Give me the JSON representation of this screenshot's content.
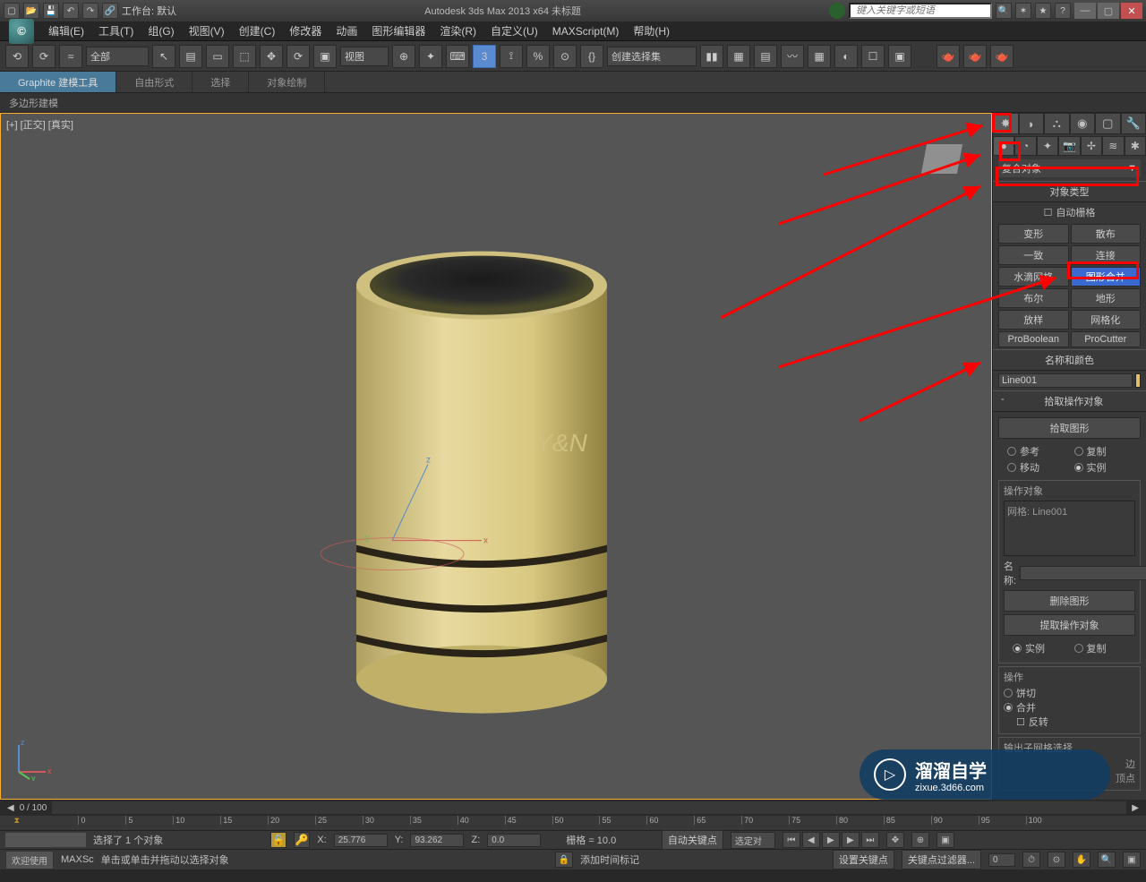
{
  "titlebar": {
    "workspace_label": "工作台: 默认",
    "app_title": "Autodesk 3ds Max  2013 x64      未标题",
    "search_placeholder": "键入关键字或短语"
  },
  "menus": [
    "编辑(E)",
    "工具(T)",
    "组(G)",
    "视图(V)",
    "创建(C)",
    "修改器",
    "动画",
    "图形编辑器",
    "渲染(R)",
    "自定义(U)",
    "MAXScript(M)",
    "帮助(H)"
  ],
  "toolbar": {
    "selection_filter": "全部",
    "ref_coord": "视图",
    "named_set": "创建选择集"
  },
  "ribbon": {
    "tabs": [
      "Graphite 建模工具",
      "自由形式",
      "选择",
      "对象绘制"
    ],
    "subtab": "多边形建模"
  },
  "viewport": {
    "label": "[+] [正交] [真实]",
    "watermark": "Y&N"
  },
  "panel": {
    "category": "复合对象",
    "rollups": {
      "object_type": "对象类型",
      "auto_grid": "自动栅格",
      "name_color": "名称和颜色",
      "pick_op": "拾取操作对象",
      "submesh": "输出子网格选择"
    },
    "types": [
      "变形",
      "散布",
      "一致",
      "连接",
      "水滴网格",
      "图形合并",
      "布尔",
      "地形",
      "放样",
      "网格化",
      "ProBoolean",
      "ProCutter"
    ],
    "selected_type_index": 5,
    "object_name": "Line001",
    "pick_btn": "拾取图形",
    "radios1": {
      "ref": "参考",
      "copy": "复制",
      "move": "移动",
      "inst": "实例"
    },
    "op_obj_title": "操作对象",
    "op_obj_item": "网格: Line001",
    "name_label": "名称:",
    "del_shape": "删除图形",
    "extract_op": "提取操作对象",
    "radios2": {
      "inst": "实例",
      "copy": "复制"
    },
    "operation_title": "操作",
    "op_pie": "饼切",
    "op_merge": "合并",
    "op_invert": "反转",
    "collapse_edge": "边",
    "collapse_vertex": "顶点"
  },
  "timeline": {
    "frame_label": "0 / 100",
    "marks": [
      "0",
      "5",
      "10",
      "15",
      "20",
      "25",
      "30",
      "35",
      "40",
      "45",
      "50",
      "55",
      "60",
      "65",
      "70",
      "75",
      "80",
      "85",
      "90",
      "95",
      "100"
    ]
  },
  "status": {
    "selection": "选择了 1 个对象",
    "prompt": "单击或单击并拖动以选择对象",
    "x": "25.776",
    "y": "93.262",
    "z": "0.0",
    "grid": "栅格 = 10.0",
    "auto_key": "自动关键点",
    "sel_lock": "选定对",
    "set_key": "设置关键点",
    "key_filter": "关键点过滤器...",
    "add_time_tag": "添加时间标记",
    "welcome": "欢迎使用",
    "maxscript": "MAXSc"
  },
  "badge": {
    "text": "溜溜自学",
    "url": "zixue.3d66.com"
  },
  "coords": {
    "x_lbl": "X:",
    "y_lbl": "Y:",
    "z_lbl": "Z:"
  }
}
